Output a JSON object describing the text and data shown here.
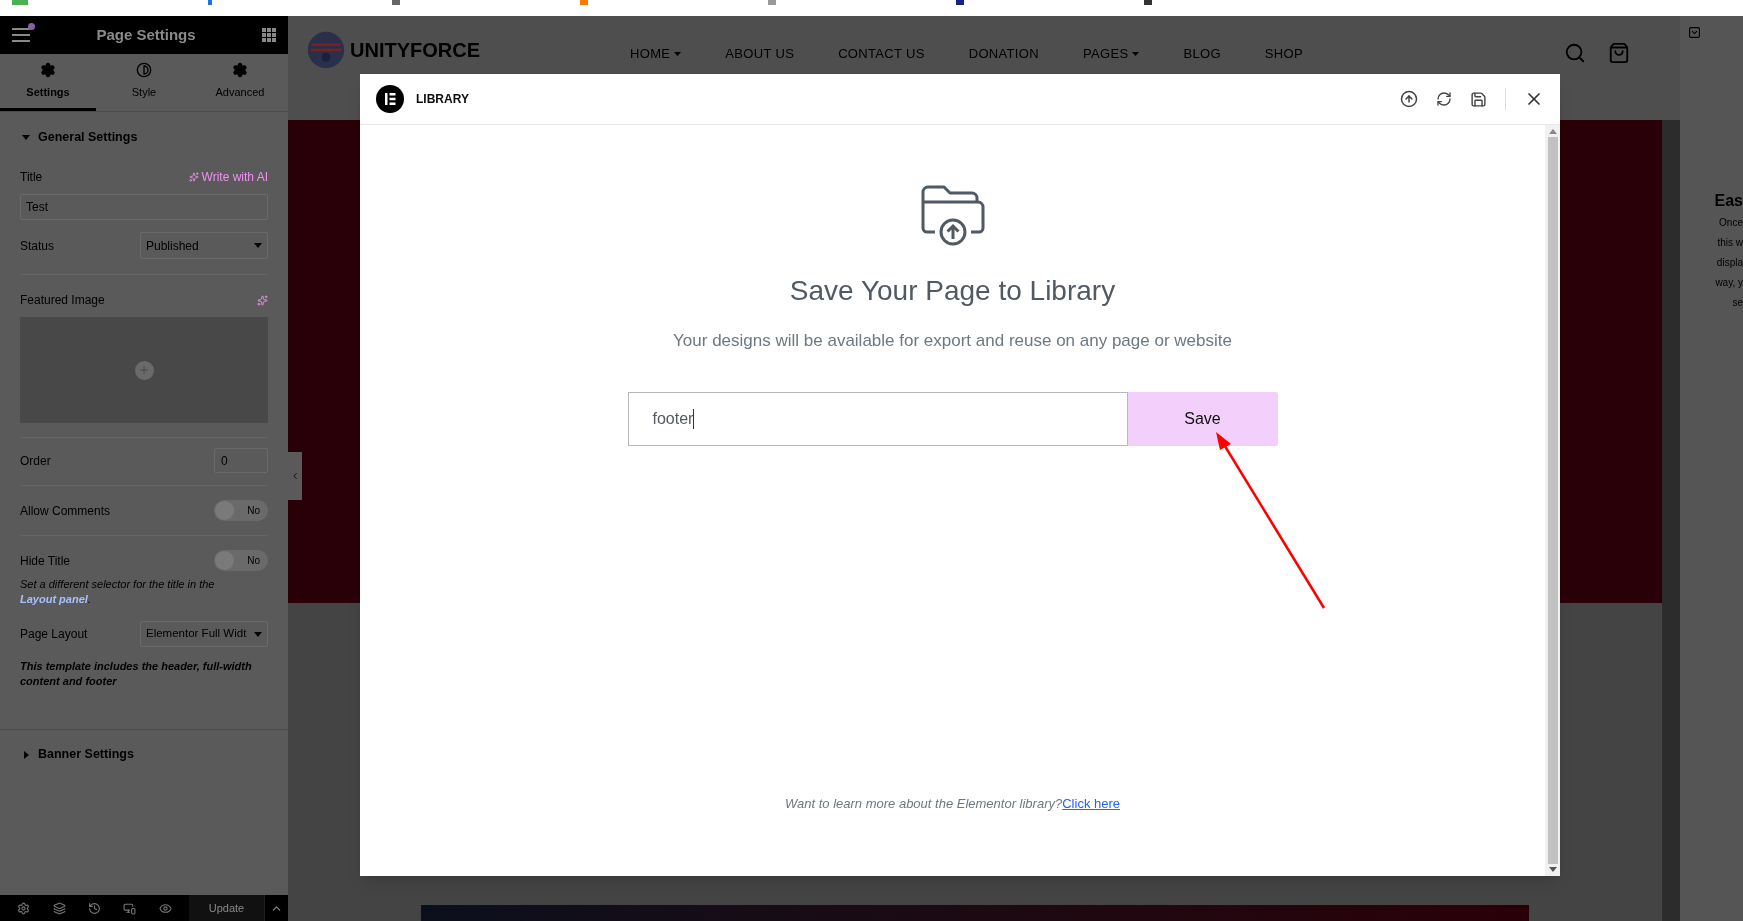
{
  "panel": {
    "title": "Page Settings",
    "tabs": [
      {
        "label": "Settings",
        "selected": true
      },
      {
        "label": "Style",
        "selected": false
      },
      {
        "label": "Advanced",
        "selected": false
      }
    ],
    "general": {
      "title": "General Settings",
      "expanded": true,
      "title_field": {
        "label": "Title",
        "ai_link": "Write with AI",
        "value": "Test"
      },
      "status": {
        "label": "Status",
        "value": "Published"
      },
      "featured_image": {
        "label": "Featured Image"
      },
      "order": {
        "label": "Order",
        "value": "0"
      },
      "allow_comments": {
        "label": "Allow Comments",
        "on": false,
        "state_text": "No"
      },
      "hide_title": {
        "label": "Hide Title",
        "on": false,
        "state_text": "No",
        "note": "Set a different selector for the title in the",
        "note_link": "Layout panel",
        "note_end": "."
      },
      "page_layout": {
        "label": "Page Layout",
        "value": "Elementor Full Widt",
        "note": "This template includes the header, full-width content and footer"
      }
    },
    "banner": {
      "title": "Banner Settings",
      "expanded": false
    },
    "footer": {
      "update": "Update"
    }
  },
  "site": {
    "logo": "UNITYFORCE",
    "nav": [
      {
        "label": "HOME",
        "dropdown": true
      },
      {
        "label": "ABOUT US",
        "dropdown": false
      },
      {
        "label": "CONTACT US",
        "dropdown": false
      },
      {
        "label": "DONATION",
        "dropdown": false
      },
      {
        "label": "PAGES",
        "dropdown": true
      },
      {
        "label": "BLOG",
        "dropdown": false
      },
      {
        "label": "SHOP",
        "dropdown": false
      }
    ],
    "side_title": "Eas",
    "side_lines": [
      "Once",
      "this w",
      "displa",
      "way, y",
      "se"
    ]
  },
  "modal": {
    "title": "LIBRARY",
    "heading": "Save Your Page to Library",
    "subtitle": "Your designs will be available for export and reuse on any page or website",
    "input_value": "footer",
    "save": "Save",
    "footer_text": "Want to learn more about the Elementor library?",
    "footer_link": "Click here"
  }
}
